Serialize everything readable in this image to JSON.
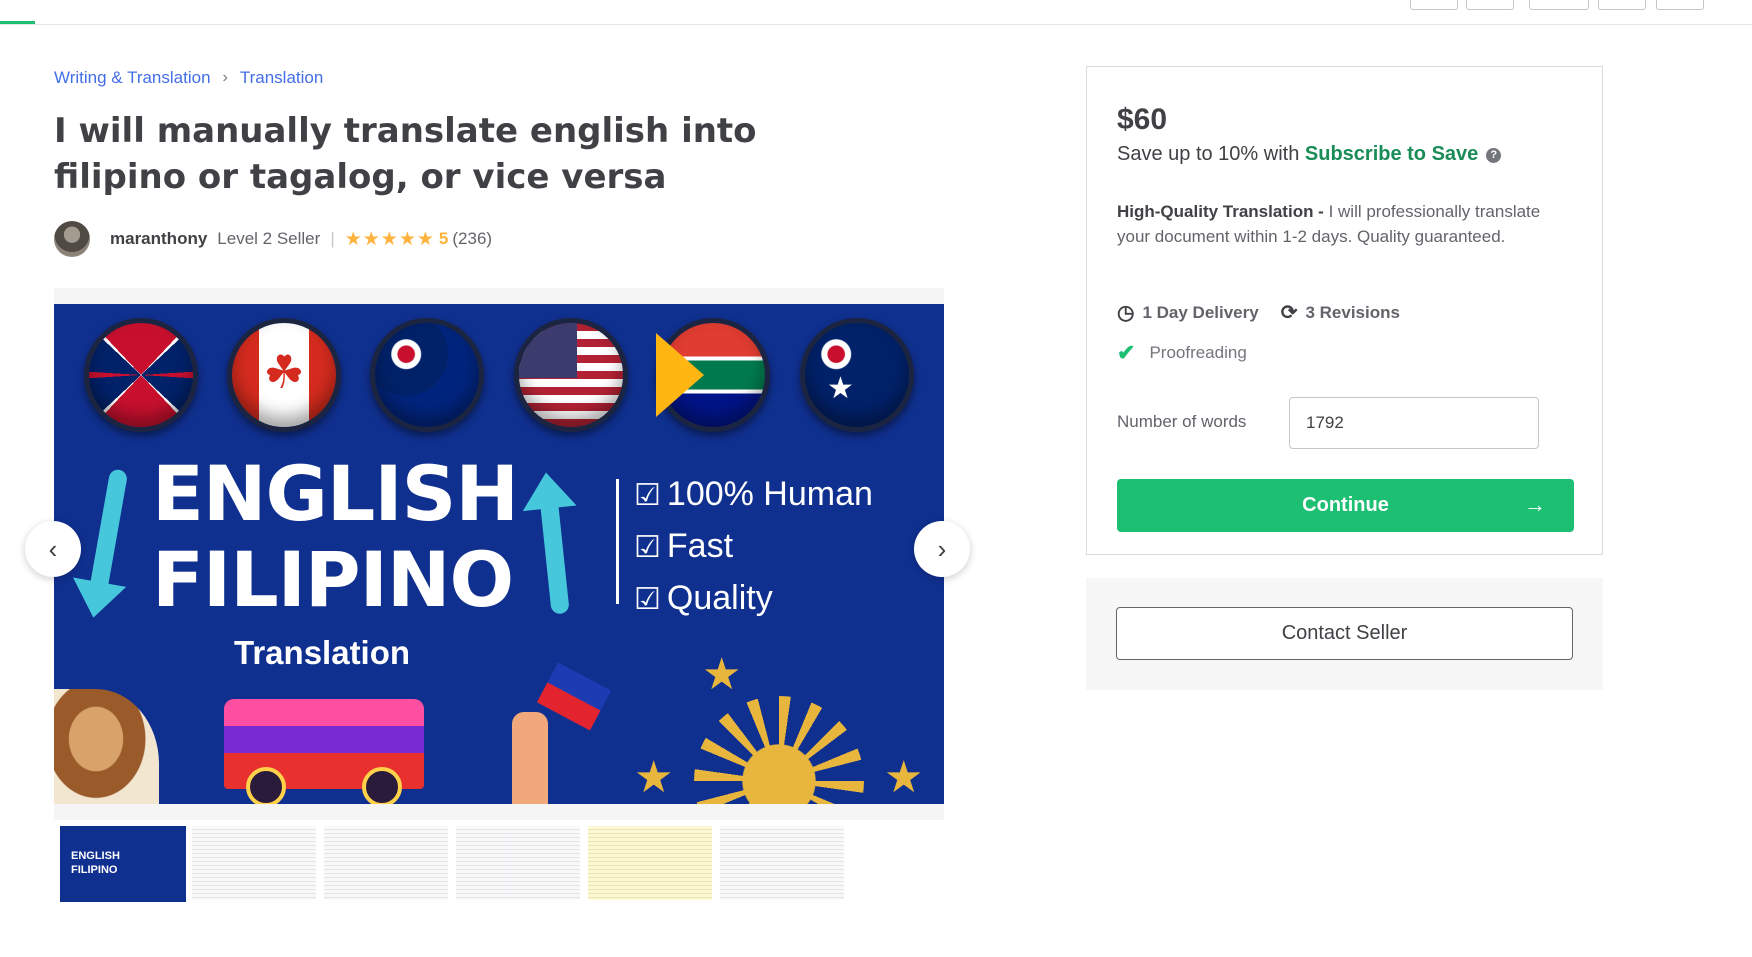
{
  "breadcrumb": {
    "category": "Writing & Translation",
    "separator": "›",
    "subcategory": "Translation"
  },
  "gig": {
    "title": "I will manually translate english into filipino or tagalog, or vice versa"
  },
  "seller": {
    "name": "maranthony",
    "level": "Level 2 Seller",
    "divider": "|",
    "stars": "★★★★★",
    "rating": "5",
    "reviews": "(236)"
  },
  "hero_image": {
    "line1": "ENGLISH",
    "line2": "FILIPINO",
    "subtitle": "Translation",
    "features": [
      "100% Human",
      "Fast",
      "Quality"
    ],
    "check_glyph": "☑"
  },
  "gallery": {
    "prev_icon": "‹",
    "next_icon": "›"
  },
  "package": {
    "price": "$60",
    "save_prefix": "Save up to 10% with ",
    "save_link": "Subscribe to Save",
    "help_glyph": "?",
    "desc_title": "High-Quality Translation - ",
    "desc_body": "I will professionally translate your document within 1-2 days. Quality guaranteed.",
    "delivery": "1 Day Delivery",
    "revisions": "3 Revisions",
    "clock_glyph": "◷",
    "refresh_glyph": "⟳",
    "check_glyph": "✔",
    "feature": "Proofreading",
    "words_label": "Number of words",
    "words_value": "1792",
    "continue_label": "Continue",
    "continue_arrow": "→",
    "contact_label": "Contact Seller"
  },
  "colors": {
    "brand_green": "#1dbf73",
    "link_blue": "#446ee7",
    "star": "#ffb33e",
    "hero_bg": "#10308f"
  }
}
